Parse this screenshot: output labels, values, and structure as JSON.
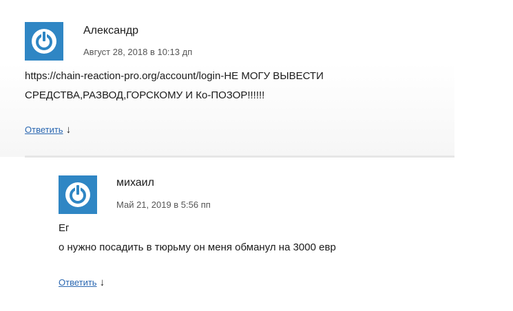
{
  "comments": [
    {
      "author": "Александр",
      "date": "Август 28, 2018 в 10:13 дп",
      "lines": [
        "https://chain-reaction-pro.org/account/login-НЕ МОГУ ВЫВЕСТИ",
        "СРЕДСТВА,РАЗВОД,ГОРСКОМУ И Ко-ПОЗОР!!!!!!"
      ],
      "reply_label": "Ответить",
      "reply_arrow": "↓",
      "avatar_icon": "power-icon"
    },
    {
      "author": "михаил",
      "date": "Май 21, 2019 в 5:56 пп",
      "lines": [
        "Ег",
        "о нужно посадить в тюрьму он меня обманул на 3000 евр"
      ],
      "reply_label": "Ответить",
      "reply_arrow": "↓",
      "avatar_icon": "power-icon"
    }
  ],
  "colors": {
    "avatar_bg": "#2f86c4",
    "link": "#2a67b1"
  }
}
